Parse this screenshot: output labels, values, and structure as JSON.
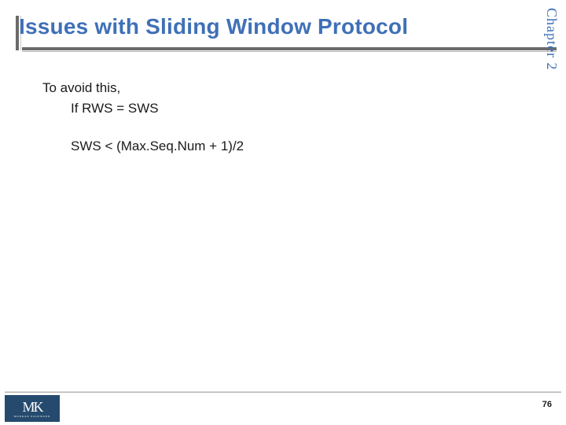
{
  "sidebar": {
    "chapter_label": "Chapter 2"
  },
  "title": "Issues with Sliding Window Protocol",
  "content": {
    "line1": "To avoid this,",
    "line2": "If RWS = SWS",
    "line3": "SWS < (Max.Seq.Num + 1)/2"
  },
  "footer": {
    "logo_main": "MK",
    "logo_sub": "MORGAN KAUFMANN",
    "page_number": "76"
  }
}
